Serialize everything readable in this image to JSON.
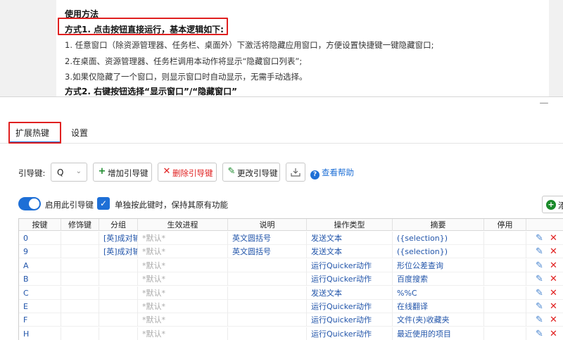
{
  "doc": {
    "lines": [
      "使用方法",
      "方式1. 点击按钮直接运行，基本逻辑如下:",
      "1. 任意窗口（除资源管理器、任务栏、桌面外）下激活将隐藏应用窗口，方便设置快捷键一键隐藏窗口;",
      "2.在桌面、资源管理器、任务栏调用本动作将显示“隐藏窗口列表”;",
      "3.如果仅隐藏了一个窗口，则显示窗口时自动显示，无需手动选择。",
      "方式2. 右键按钮选择“显示窗口”/“隐藏窗口”"
    ]
  },
  "window": {
    "minimize_glyph": "—"
  },
  "tabs": [
    {
      "label": "扩展热键"
    },
    {
      "label": "设置"
    }
  ],
  "toolbar": {
    "key_label": "引导键:",
    "key_value": "Q",
    "add_label": "增加引导键",
    "delete_label": "删除引导键",
    "edit_label": "更改引导键",
    "help_label": "查看帮助"
  },
  "options": {
    "enable_label": "启用此引导键",
    "keep_label": "单独按此键时，保持其原有功能",
    "add_right_label": "添"
  },
  "table": {
    "headers": [
      "按键",
      "修饰键",
      "分组",
      "生效进程",
      "说明",
      "操作类型",
      "摘要",
      "停用"
    ],
    "rows": [
      {
        "key": "0",
        "mod": "",
        "group": "[英]成对输",
        "proc": "*默认*",
        "desc": "英文圆括号",
        "type": "发送文本",
        "summary": "({selection})",
        "disabled": ""
      },
      {
        "key": "9",
        "mod": "",
        "group": "[英]成对输",
        "proc": "*默认*",
        "desc": "英文圆括号",
        "type": "发送文本",
        "summary": "({selection})",
        "disabled": ""
      },
      {
        "key": "A",
        "mod": "",
        "group": "",
        "proc": "*默认*",
        "desc": "",
        "type": "运行Quicker动作",
        "summary": "形位公差查询",
        "disabled": ""
      },
      {
        "key": "B",
        "mod": "",
        "group": "",
        "proc": "*默认*",
        "desc": "",
        "type": "运行Quicker动作",
        "summary": "百度搜索",
        "disabled": ""
      },
      {
        "key": "C",
        "mod": "",
        "group": "",
        "proc": "*默认*",
        "desc": "",
        "type": "发送文本",
        "summary": "%%C",
        "disabled": ""
      },
      {
        "key": "E",
        "mod": "",
        "group": "",
        "proc": "*默认*",
        "desc": "",
        "type": "运行Quicker动作",
        "summary": "在线翻译",
        "disabled": ""
      },
      {
        "key": "F",
        "mod": "",
        "group": "",
        "proc": "*默认*",
        "desc": "",
        "type": "运行Quicker动作",
        "summary": "文件(夹)收藏夹",
        "disabled": ""
      },
      {
        "key": "H",
        "mod": "",
        "group": "",
        "proc": "*默认*",
        "desc": "",
        "type": "运行Quicker动作",
        "summary": "最近使用的项目",
        "disabled": ""
      }
    ]
  },
  "colors": {
    "accent": "#1e6fd6",
    "danger": "#e02020",
    "highlight_box": "#e02020",
    "success": "#1a8a2a"
  }
}
